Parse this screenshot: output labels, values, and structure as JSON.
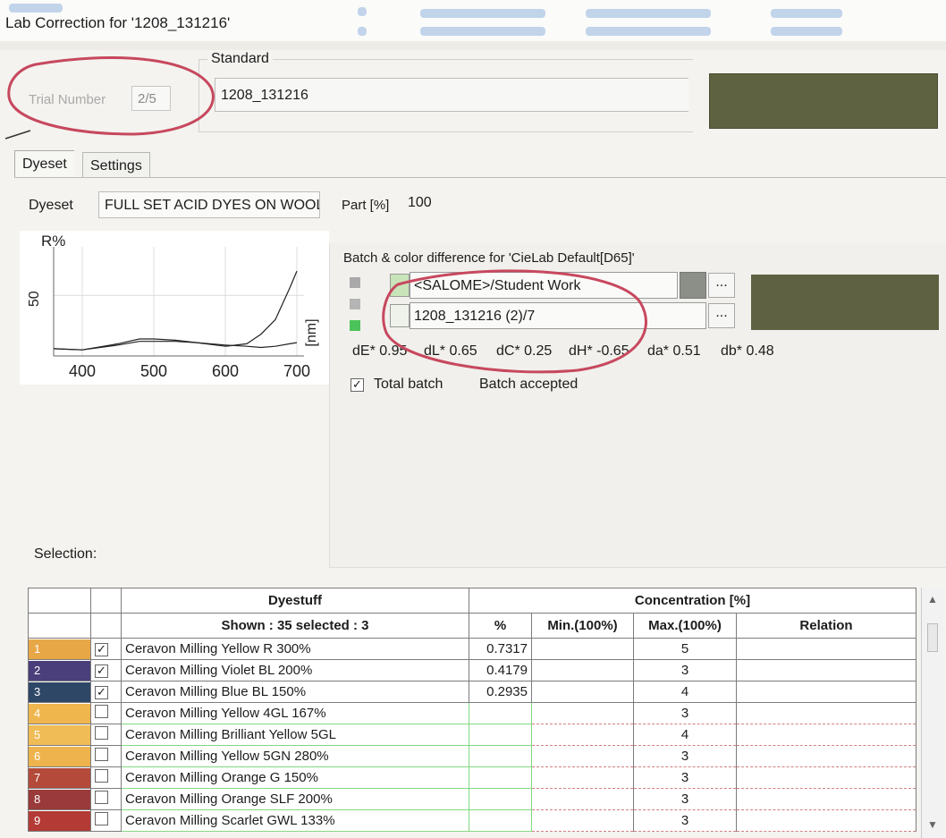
{
  "window": {
    "title": "Lab Correction for '1208_131216'"
  },
  "trial": {
    "label": "Trial Number",
    "value": "2/5"
  },
  "standard": {
    "legend": "Standard",
    "name": "1208_131216",
    "color": "#5e6240"
  },
  "tabs": [
    {
      "label": "Dyeset",
      "active": true
    },
    {
      "label": "Settings",
      "active": false
    }
  ],
  "dyeset": {
    "label": "Dyeset",
    "value": "FULL SET ACID DYES ON WOOL",
    "part_label": "Part [%]",
    "part_value": "100"
  },
  "chart_data": {
    "type": "line",
    "ylabel": "R%",
    "xlabel": "[nm]",
    "y_tick": "50",
    "x_ticks": [
      "400",
      "500",
      "600",
      "700"
    ],
    "xlim": [
      360,
      710
    ],
    "ylim": [
      0,
      90
    ],
    "series": [
      {
        "x": [
          360,
          400,
          450,
          480,
          500,
          530,
          560,
          600,
          630,
          650,
          670,
          690,
          700
        ],
        "y": [
          6,
          5,
          10,
          14,
          14,
          13,
          11,
          8,
          10,
          18,
          30,
          56,
          70
        ]
      },
      {
        "x": [
          360,
          400,
          450,
          480,
          500,
          530,
          560,
          600,
          630,
          650,
          670,
          690,
          700
        ],
        "y": [
          6,
          5,
          9,
          12,
          12,
          12,
          11,
          9,
          8,
          7,
          8,
          10,
          11
        ]
      }
    ]
  },
  "batch": {
    "legend": "Batch & color difference for 'CieLab Default[D65]'",
    "source": "<SALOME>/Student Work",
    "name": "1208_131216 (2)/7",
    "dots": "...",
    "color": "#5e6142",
    "diff": [
      "dE* 0.95",
      "dL* 0.65",
      "dC* 0.25",
      "dH* -0.65",
      "da* 0.51",
      "db* 0.48"
    ],
    "total_batch": "Total batch",
    "status": "Batch accepted"
  },
  "selection": {
    "label": "Selection:"
  },
  "table": {
    "group_dyestuff": "Dyestuff",
    "group_conc": "Concentration [%]",
    "shown": "Shown : 35 selected : 3",
    "col_pct": "%",
    "col_min": "Min.(100%)",
    "col_max": "Max.(100%)",
    "col_rel": "Relation",
    "rows": [
      {
        "num": "1",
        "color": "#e8a747",
        "checked": true,
        "name": "Ceravon Milling Yellow R 300%",
        "pct": "0.7317",
        "max": "5"
      },
      {
        "num": "2",
        "color": "#4a3f7a",
        "checked": true,
        "name": "Ceravon Milling Violet BL 200%",
        "pct": "0.4179",
        "max": "3"
      },
      {
        "num": "3",
        "color": "#2e4766",
        "checked": true,
        "name": "Ceravon Milling Blue BL 150%",
        "pct": "0.2935",
        "max": "4"
      },
      {
        "num": "4",
        "color": "#efb64e",
        "checked": false,
        "name": "Ceravon Milling Yellow 4GL 167%",
        "pct": "",
        "max": "3"
      },
      {
        "num": "5",
        "color": "#f0bc55",
        "checked": false,
        "name": "Ceravon Milling Brilliant Yellow 5GL",
        "pct": "",
        "max": "4"
      },
      {
        "num": "6",
        "color": "#eeb34c",
        "checked": false,
        "name": "Ceravon Milling Yellow 5GN 280%",
        "pct": "",
        "max": "3"
      },
      {
        "num": "7",
        "color": "#b34a3a",
        "checked": false,
        "name": "Ceravon Milling Orange G 150%",
        "pct": "",
        "max": "3"
      },
      {
        "num": "8",
        "color": "#9a3a3a",
        "checked": false,
        "name": "Ceravon Milling Orange SLF 200%",
        "pct": "",
        "max": "3"
      },
      {
        "num": "9",
        "color": "#b33a35",
        "checked": false,
        "name": "Ceravon Milling Scarlet GWL 133%",
        "pct": "",
        "max": "3"
      }
    ]
  }
}
